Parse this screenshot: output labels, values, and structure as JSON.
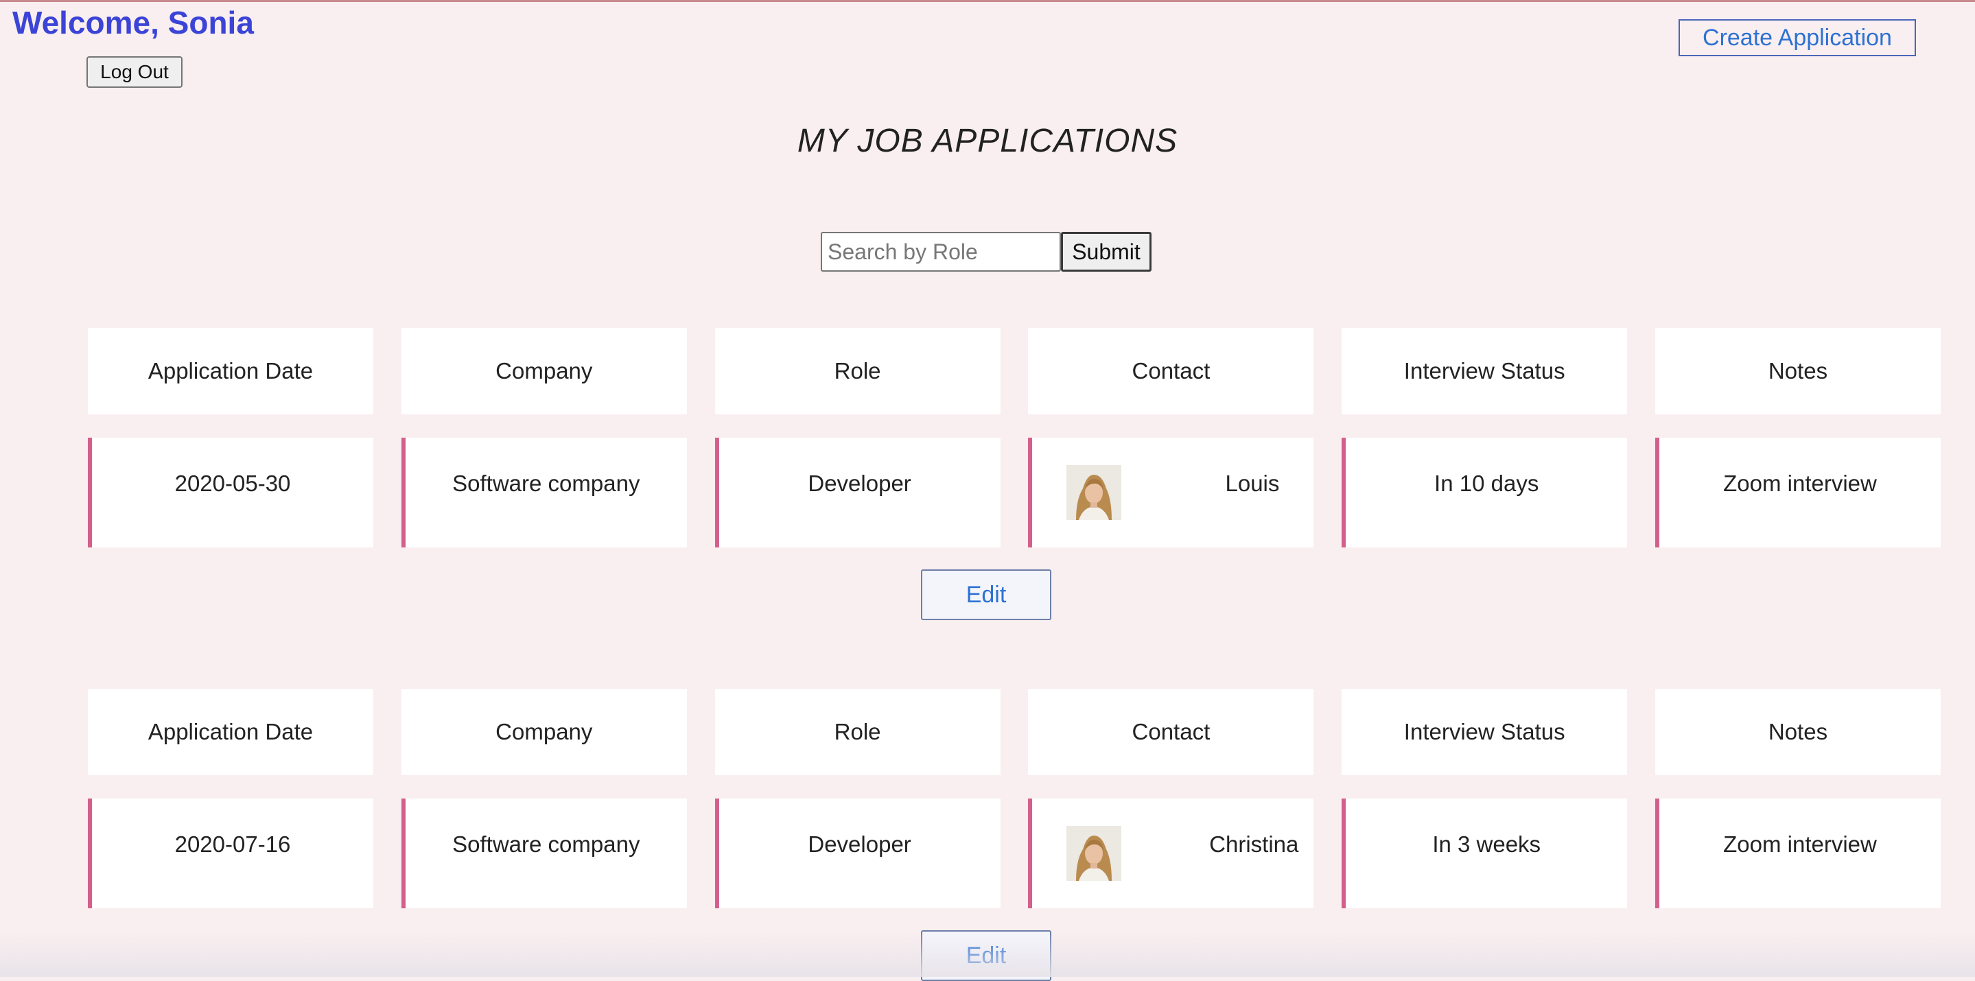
{
  "header": {
    "welcome": "Welcome, Sonia",
    "logout_label": "Log Out",
    "create_label": "Create Application"
  },
  "page_title": "MY JOB APPLICATIONS",
  "search": {
    "placeholder": "Search by Role",
    "value": "",
    "submit_label": "Submit"
  },
  "columns": [
    "Application Date",
    "Company",
    "Role",
    "Contact",
    "Interview Status",
    "Notes"
  ],
  "applications": [
    {
      "date": "2020-05-30",
      "company": "Software company",
      "role": "Developer",
      "contact": "Louis",
      "status": "In 10 days",
      "notes": "Zoom interview",
      "edit_label": "Edit"
    },
    {
      "date": "2020-07-16",
      "company": "Software company",
      "role": "Developer",
      "contact": "Christina",
      "status": "In 3 weeks",
      "notes": "Zoom interview",
      "edit_label": "Edit"
    }
  ],
  "colors": {
    "background": "#f9eef0",
    "welcome": "#3b44d6",
    "link_blue": "#2d72d2",
    "accent_border": "#d45f8c"
  }
}
